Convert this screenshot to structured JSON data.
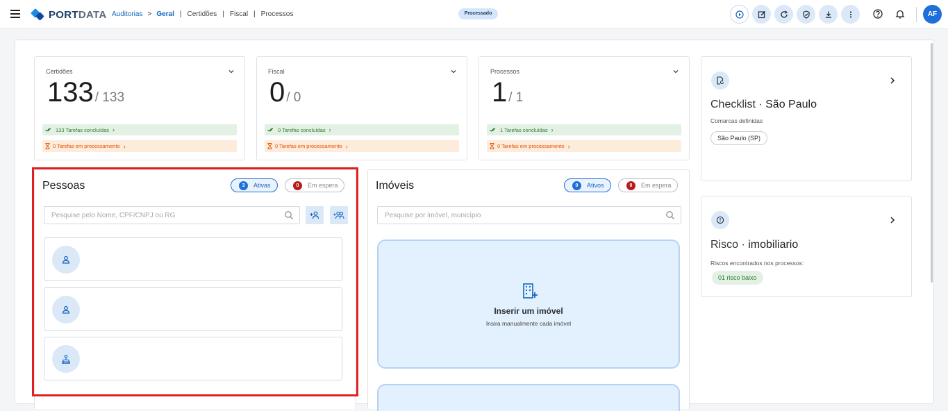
{
  "header": {
    "brand_port": "PORT",
    "brand_data": "DATA",
    "breadcrumb_root": "Auditorias",
    "breadcrumb_sep": ">",
    "breadcrumb_active": "Geral",
    "breadcrumb_items": [
      "Certidões",
      "Fiscal",
      "Processos"
    ],
    "status": "Processado",
    "avatar_initials": "AF",
    "action_icons": [
      "play-icon",
      "edit-icon",
      "refresh-icon",
      "shield-check-icon",
      "download-icon",
      "more-vertical-icon"
    ],
    "utility_icons": [
      "help-icon",
      "bell-icon"
    ]
  },
  "stats": [
    {
      "title": "Certidões",
      "value": "133",
      "total": "/ 133",
      "done_label": "133 Tarefas concluídas",
      "processing_label": "0 Tarefas em processamento"
    },
    {
      "title": "Fiscal",
      "value": "0",
      "total": "/ 0",
      "done_label": "0 Tarefas concluídas",
      "processing_label": "0 Tarefas em processamento"
    },
    {
      "title": "Processos",
      "value": "1",
      "total": "/ 1",
      "done_label": "1 Tarefas concluídas",
      "processing_label": "0 Tarefas em processamento"
    }
  ],
  "pessoas": {
    "title": "Pessoas",
    "active_count": "3",
    "active_label": "Ativas",
    "waiting_count": "0",
    "waiting_label": "Em espera",
    "search_placeholder": "Pesquise pelo Nome, CPF/CNPJ ou RG",
    "items": [
      {
        "icon": "person-icon"
      },
      {
        "icon": "person-icon"
      },
      {
        "icon": "company-icon"
      }
    ]
  },
  "imoveis": {
    "title": "Imóveis",
    "active_count": "0",
    "active_label": "Ativos",
    "waiting_count": "0",
    "waiting_label": "Em espera",
    "search_placeholder": "Pesquise por imóvel, município",
    "insert_title": "Inserir um imóvel",
    "insert_subtitle": "Insira manualmente cada imóvel"
  },
  "checklist": {
    "title_main": "Checklist",
    "title_dot": " · ",
    "title_place": "São Paulo",
    "subtitle": "Comarcas definidas",
    "chip": "São Paulo (SP)"
  },
  "risco": {
    "title_main": "Risco",
    "title_dot": " · ",
    "title_place": "imobiliario",
    "subtitle": "Riscos encontrados nos processos:",
    "chip": "01 risco baixo"
  },
  "colors": {
    "accent": "#1e6fd9",
    "success": "#2e7d32",
    "warning": "#e65100",
    "danger": "#b71c1c",
    "highlight": "#e02020"
  }
}
